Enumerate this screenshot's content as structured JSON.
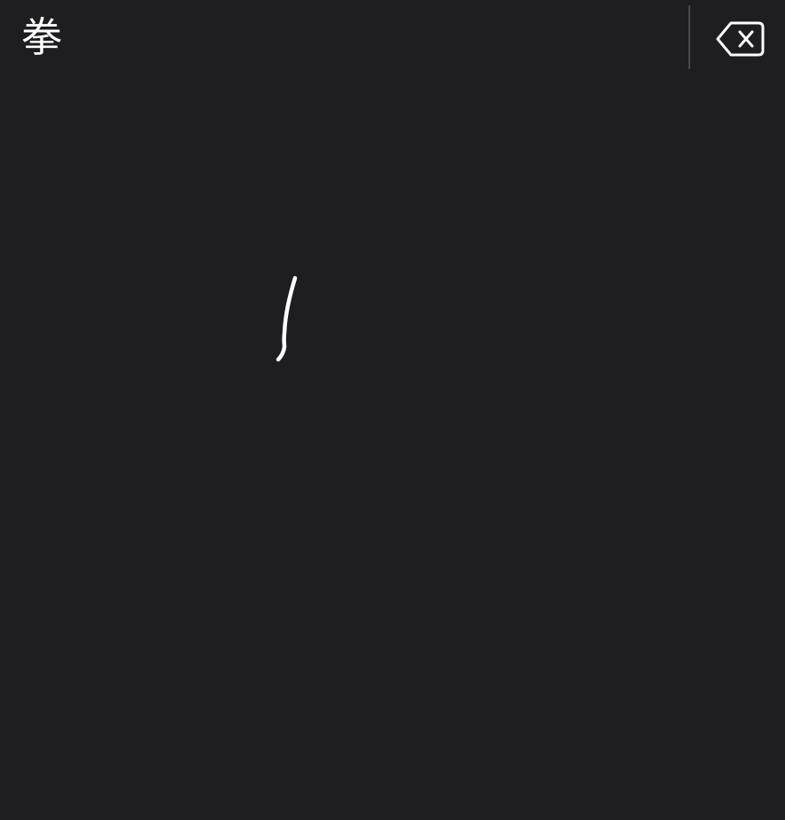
{
  "candidates": [
    {
      "text": "拳"
    }
  ],
  "delete_key": {
    "icon": "backspace-icon"
  },
  "handwriting": {
    "stroke_count": 1,
    "ink_color": "#ffffff",
    "background_color": "#1e1d20"
  }
}
